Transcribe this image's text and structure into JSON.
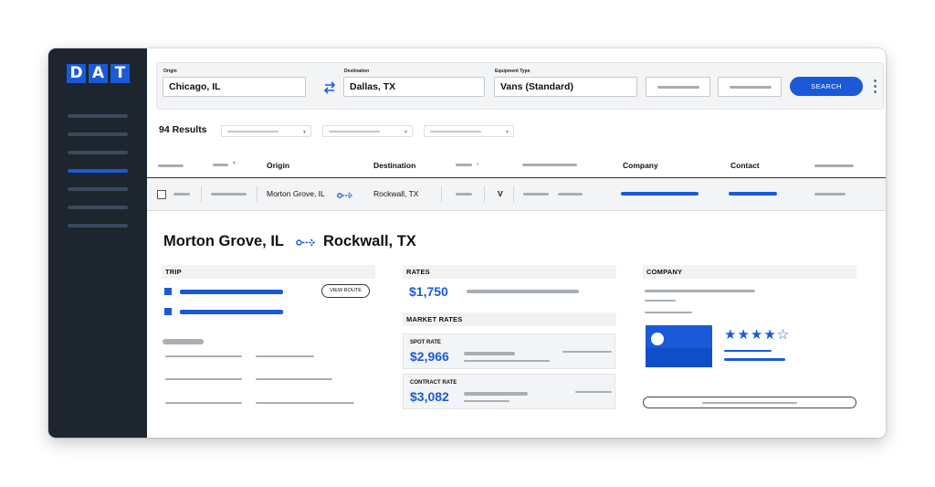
{
  "logo": [
    "D",
    "A",
    "T"
  ],
  "search": {
    "origin_label": "Origin",
    "origin_value": "Chicago, IL",
    "destination_label": "Destination",
    "destination_value": "Dallas, TX",
    "equipment_label": "Equipment Type",
    "equipment_value": "Vans (Standard)",
    "search_button": "SEARCH"
  },
  "results": {
    "count_label": "94 Results"
  },
  "table": {
    "headers": {
      "origin": "Origin",
      "destination": "Destination",
      "company": "Company",
      "contact": "Contact"
    },
    "row": {
      "origin": "Morton Grove, IL",
      "destination": "Rockwall, TX",
      "equipment": "V"
    }
  },
  "detail": {
    "origin": "Morton Grove, IL",
    "destination": "Rockwall, TX",
    "trip_header": "TRIP",
    "view_route": "VIEW ROUTE",
    "rates_header": "RATES",
    "rate_value": "$1,750",
    "market_rates_header": "MARKET RATES",
    "spot_label": "SPOT RATE",
    "spot_value": "$2,966",
    "contract_label": "CONTRACT RATE",
    "contract_value": "$3,082",
    "company_header": "COMPANY",
    "stars": "★★★★☆",
    "rating": 4
  },
  "colors": {
    "accent": "#1a5ad9",
    "sidebar": "#1d252e"
  },
  "icons": {
    "swap": "swap-arrows-icon",
    "route": "route-arrow-icon",
    "more": "kebab-menu-icon"
  }
}
